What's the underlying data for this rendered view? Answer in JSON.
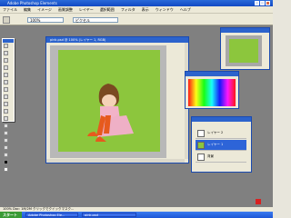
{
  "window_title": "Adobe Photoshop Elements",
  "menu": [
    "ファイル",
    "編集",
    "イメージ",
    "画質調整",
    "レイヤー",
    "選択範囲",
    "フィルタ",
    "表示",
    "ウィンドウ",
    "ヘルプ"
  ],
  "options": {
    "field1": "100%",
    "field2": "ピクセル"
  },
  "document": {
    "title": "pink.psd @ 100% (レイヤー 1, RGB)"
  },
  "layers": {
    "rows": [
      "レイヤー 2",
      "レイヤー 1",
      "背景"
    ]
  },
  "status": {
    "text": "100%    Doc: 1M/2M    クリックでクイックマスク..."
  },
  "taskbar": {
    "start_label": "スタート",
    "task1": "Adobe Photoshop Ele...",
    "task2": "pink.psd"
  },
  "colors": {
    "titlebar": "#2a6ad8",
    "canvas_green": "#8cc63d",
    "workspace": "#808080"
  }
}
